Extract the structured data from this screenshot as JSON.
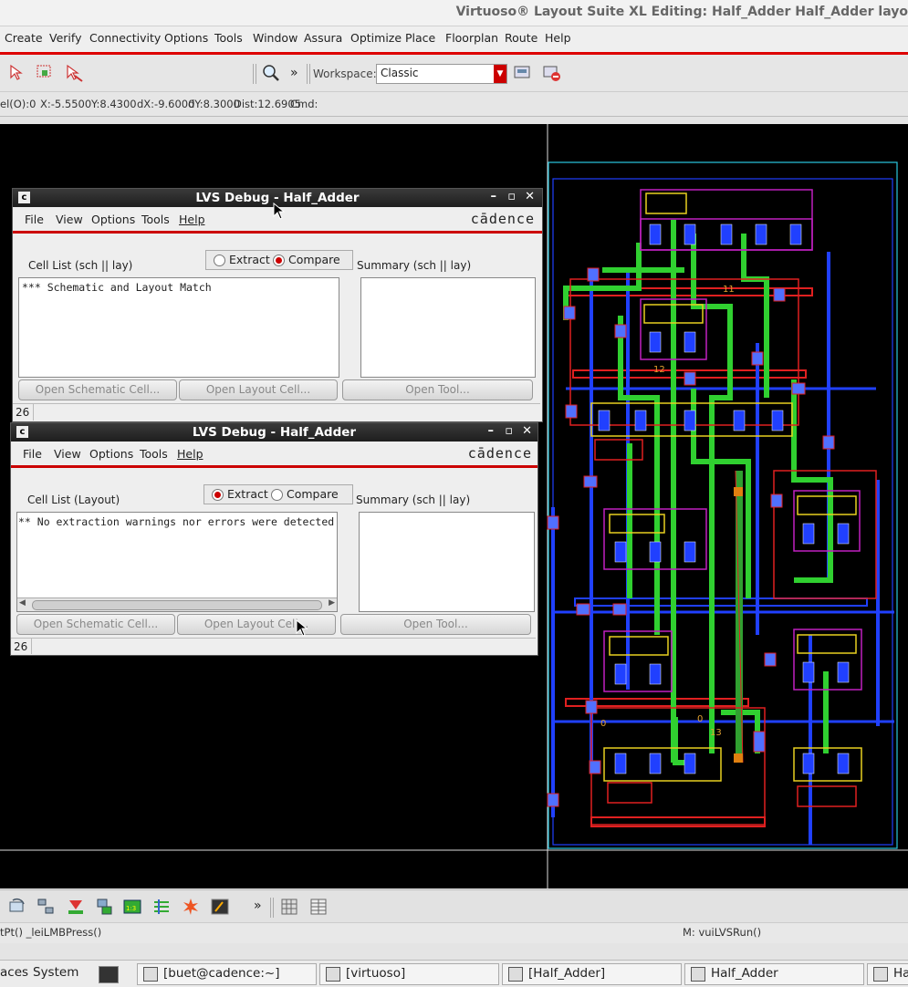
{
  "window": {
    "title": "Virtuoso® Layout Suite XL Editing: Half_Adder Half_Adder layo"
  },
  "menu": [
    "Create",
    "Verify",
    "Connectivity",
    "Options",
    "Tools",
    "Window",
    "Assura",
    "Optimize",
    "Place",
    "Floorplan",
    "Route",
    "Help"
  ],
  "toolbar": {
    "workspace_label": "Workspace:",
    "workspace_value": "Classic",
    "more": "»"
  },
  "status": {
    "sel": "el(O):0",
    "x": "X:-5.5500",
    "y": "Y:8.4300",
    "dx": "dX:-9.6000",
    "dy": "dY:8.3000",
    "dist": "Dist:12.6905",
    "cmd": "Cmd:"
  },
  "dialog1": {
    "title": "LVS Debug - Half_Adder",
    "menu": [
      "File",
      "View",
      "Options",
      "Tools",
      "Help"
    ],
    "brand": "cādence",
    "radio_extract": "Extract",
    "radio_compare": "Compare",
    "selected": "compare",
    "cell_list_label": "Cell List (sch || lay)",
    "summary_label": "Summary (sch || lay)",
    "cell_list_text": "*** Schematic and Layout Match",
    "btn_schematic": "Open Schematic Cell...",
    "btn_layout": "Open Layout Cell...",
    "btn_tool": "Open Tool...",
    "count": "26"
  },
  "dialog2": {
    "title": "LVS Debug - Half_Adder",
    "menu": [
      "File",
      "View",
      "Options",
      "Tools",
      "Help"
    ],
    "brand": "cādence",
    "radio_extract": "Extract",
    "radio_compare": "Compare",
    "selected": "extract",
    "cell_list_label": "Cell List (Layout)",
    "summary_label": "Summary (sch || lay)",
    "cell_list_text": "** No extraction warnings nor errors were detected",
    "btn_schematic": "Open Schematic Cell...",
    "btn_layout": "Open Layout Cell...",
    "btn_tool": "Open Tool...",
    "count": "26"
  },
  "layout_labels": {
    "net11": "11",
    "net12": "12",
    "net13": "13",
    "net0": "0",
    "net0b": "0"
  },
  "bottombar": {
    "more": "»"
  },
  "messages": {
    "left": "tPt() _leiLMBPress()",
    "right": "M: vuiLVSRun()"
  },
  "taskbar": [
    {
      "label": "aces"
    },
    {
      "label": "System"
    },
    {
      "label": "[buet@cadence:~]"
    },
    {
      "label": "[virtuoso]"
    },
    {
      "label": "[Half_Adder]"
    },
    {
      "label": "Half_Adder"
    },
    {
      "label": "Ha"
    }
  ],
  "colors": {
    "accent_red": "#cc0000",
    "metal1": "#2040ff",
    "metal2_green": "#30d030",
    "poly": "#e02020",
    "nwell_magenta": "#c020c0",
    "yellow": "#e8d020",
    "cyan": "#30c0e0"
  }
}
